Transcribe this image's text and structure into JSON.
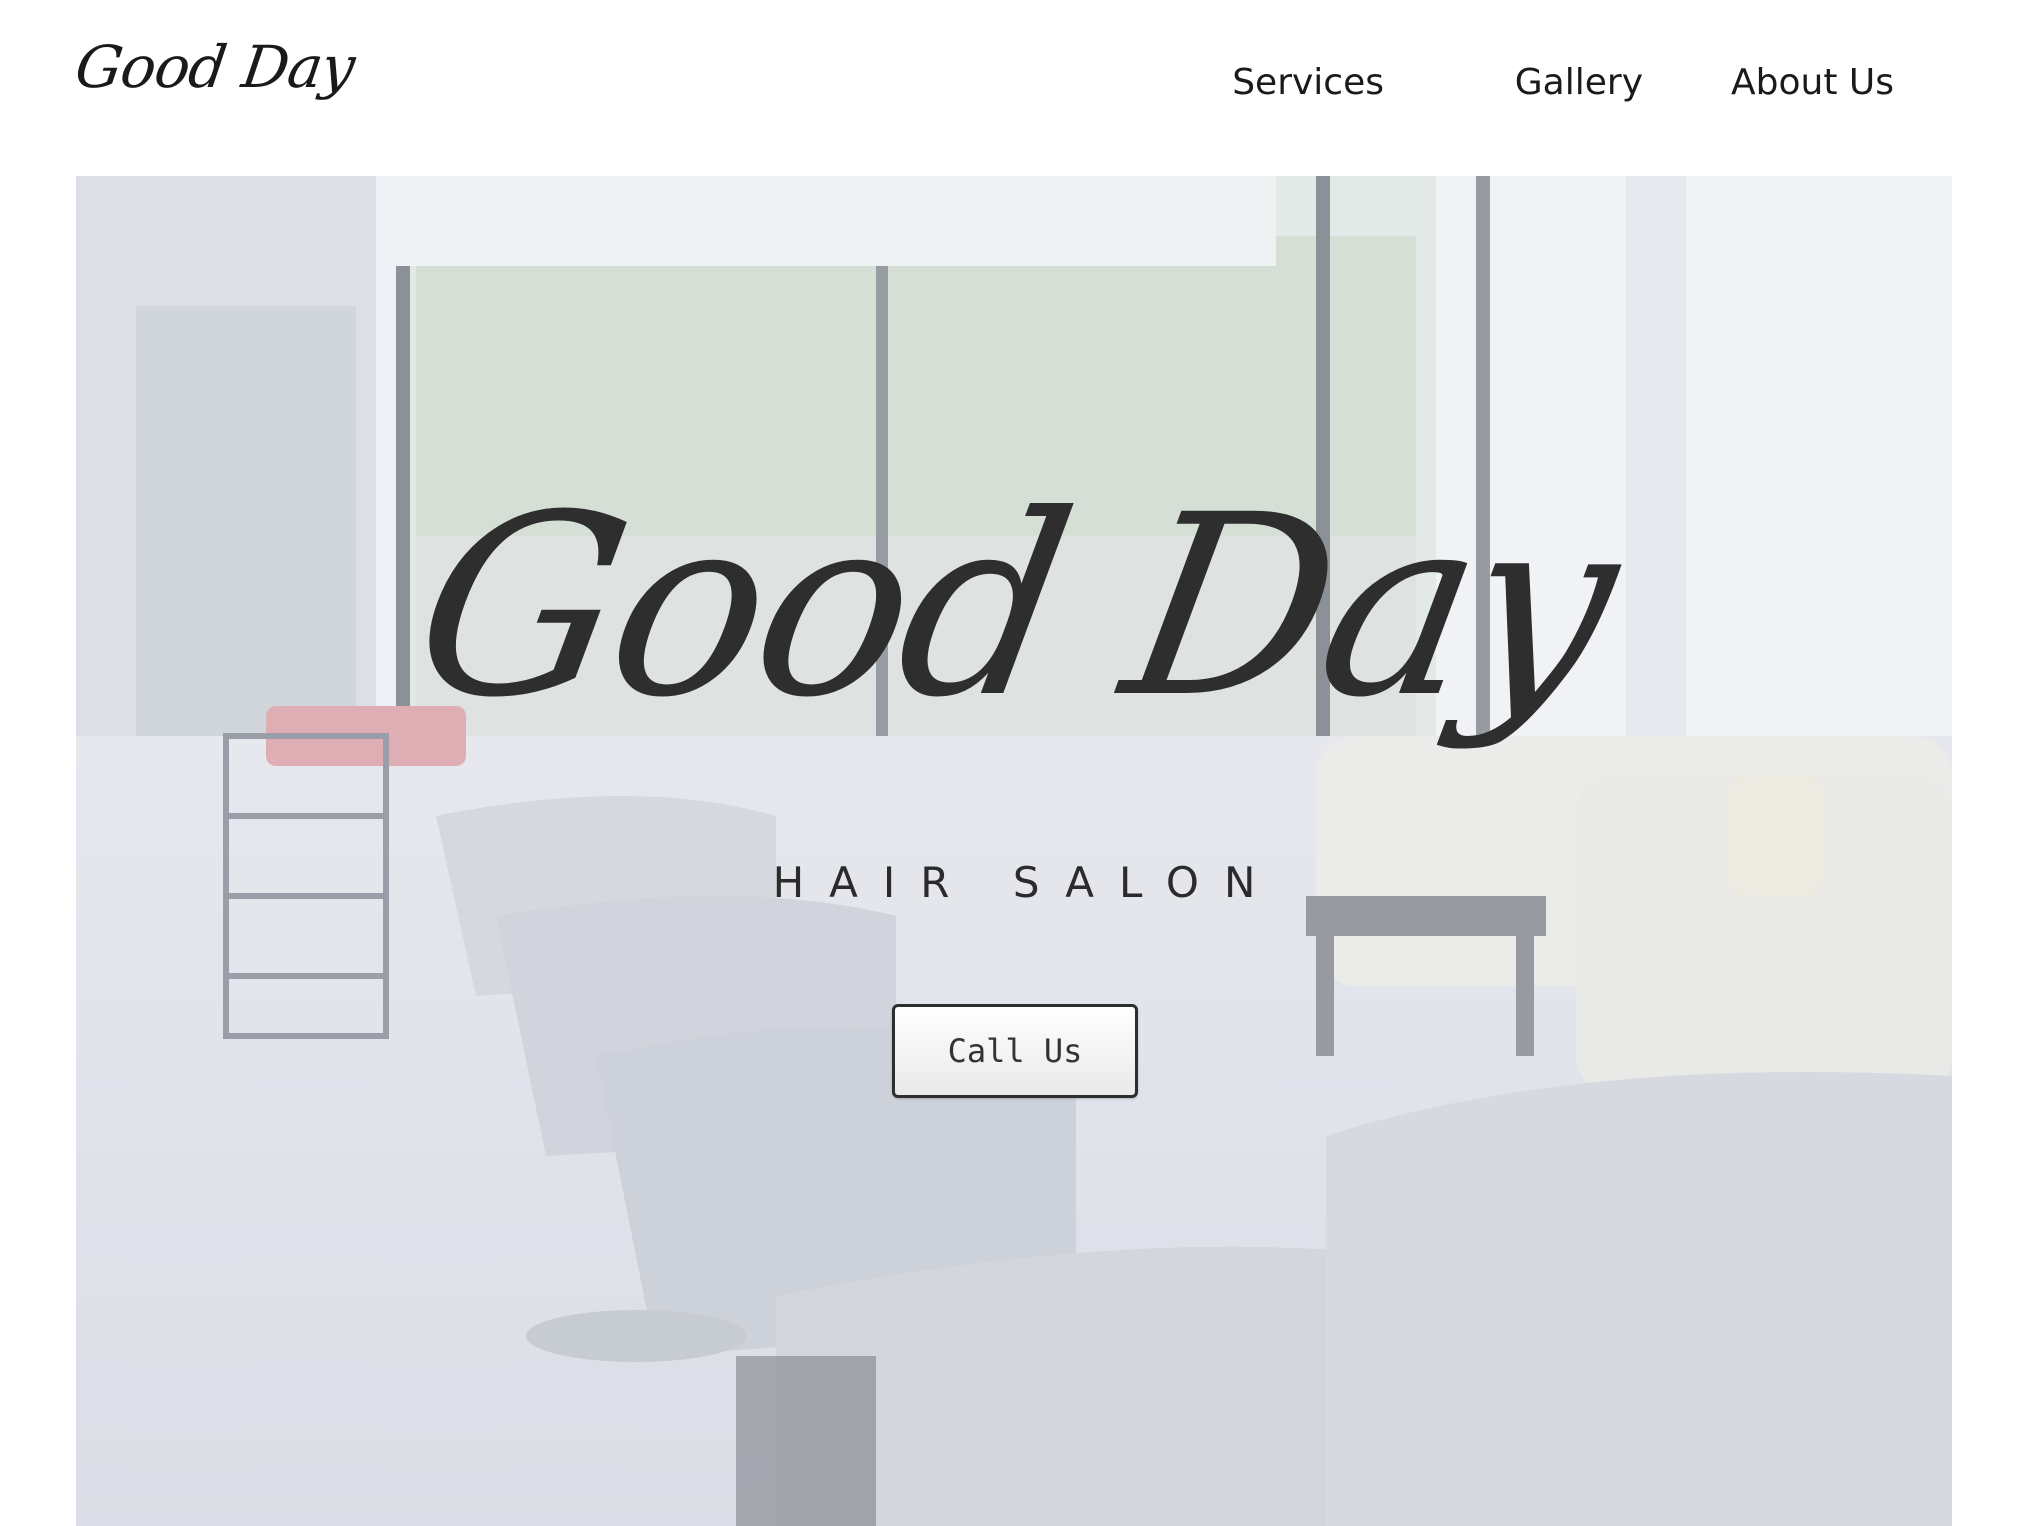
{
  "header": {
    "logo_text": "Good Day",
    "nav": [
      {
        "label": "Services"
      },
      {
        "label": "Gallery"
      },
      {
        "label": "About Us"
      }
    ]
  },
  "hero": {
    "title": "Good Day",
    "subtitle": "HAIR SALON",
    "cta_label": "Call Us"
  },
  "colors": {
    "text": "#1a1a1a",
    "hero_text": "#2e2e2e",
    "hero_tint": "#e6e8ee",
    "button_border": "#2e2e2e"
  },
  "icons": {
    "hero_image": "salon-interior-photo"
  }
}
